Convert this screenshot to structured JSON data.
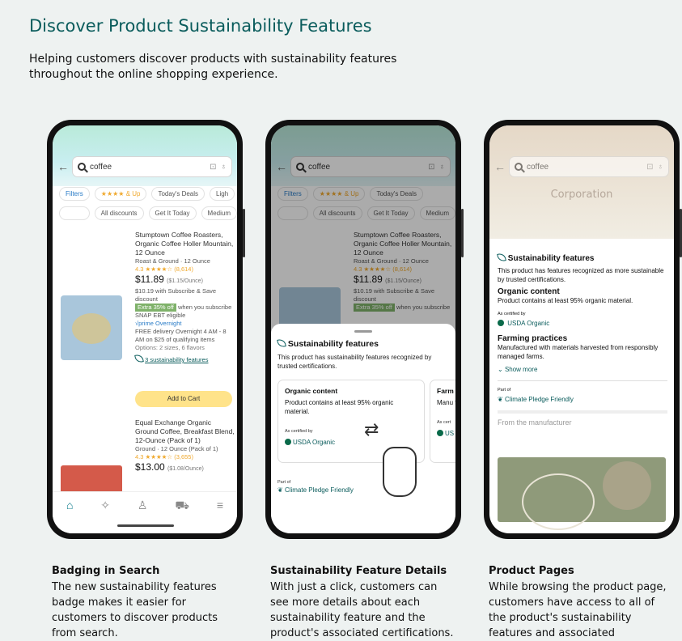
{
  "header": {
    "title": "Discover Product Sustainability Features",
    "subtitle": "Helping customers discover products with sustainability features throughout the online shopping experience."
  },
  "search_query": "coffee",
  "phone1": {
    "chips1": [
      "Filters",
      "★★★★ & Up",
      "Today's Deals",
      "Ligh"
    ],
    "chips2": [
      "",
      "All discounts",
      "Get It Today",
      "Medium"
    ],
    "product1": {
      "title": "Stumptown Coffee Roasters, Organic Coffee Holler Mountain, 12 Ounce",
      "form": "Roast & Ground · 12 Ounce",
      "rating": "4.3 ★★★★☆ (8,614)",
      "price": "$11.89",
      "price_unit": "($1.15/Ounce)",
      "subscribe": "$10.19 with Subscribe & Save discount",
      "extra": "Extra 35% off",
      "extra_note": "when you subscribe",
      "snap": "SNAP EBT eligible",
      "prime": "√prime Overnight",
      "delivery": "FREE delivery Overnight 4 AM - 8 AM on $25 of qualifying items",
      "options": "Options: 2 sizes, 6 flavors",
      "sust_link": "3 sustainability features",
      "add_to_cart": "Add to Cart"
    },
    "product2": {
      "title": "Equal Exchange Organic Ground Coffee, Breakfast Blend, 12-Ounce (Pack of 1)",
      "form": "Ground · 12 Ounce (Pack of 1)",
      "rating": "4.3 ★★★★☆ (3,655)",
      "price": "$13.00",
      "price_unit": "($1.08/Ounce)"
    }
  },
  "phone2": {
    "sheet_title": "Sustainability features",
    "sheet_desc": "This product has sustainability features recognized by trusted certifications.",
    "card1": {
      "title": "Organic content",
      "body": "Product contains at least 95% organic material.",
      "cert_by": "As certified by",
      "cert": "USDA Organic"
    },
    "card2": {
      "title": "Farm",
      "body": "Manu from",
      "cert_by": "As cert",
      "cert": "US"
    },
    "part_of": "Part of",
    "cpf": "Climate Pledge Friendly"
  },
  "phone3": {
    "banner": "Corporation",
    "title": "Sustainability features",
    "desc": "This product has features recognized as more sustainable by trusted certifications.",
    "f1_title": "Organic content",
    "f1_body": "Product contains at least 95% organic material.",
    "cert_by": "As certified by",
    "cert": "USDA Organic",
    "f2_title": "Farming practices",
    "f2_body": "Manufactured with materials harvested from responsibly managed farms.",
    "show_more": "Show more",
    "part_of": "Part of",
    "cpf": "Climate Pledge Friendly",
    "mfr": "From the manufacturer"
  },
  "captions": [
    {
      "title": "Badging in Search",
      "body": "The new sustainability features badge makes it easier for customers to discover products from search."
    },
    {
      "title": "Sustainability Feature Details",
      "body": "With just a click, customers can see more details about each sustainability feature and the product's associated certifications."
    },
    {
      "title": "Product Pages",
      "body": "While browsing the product page, customers have access to all of the product's sustainability features and associated certifications."
    }
  ]
}
